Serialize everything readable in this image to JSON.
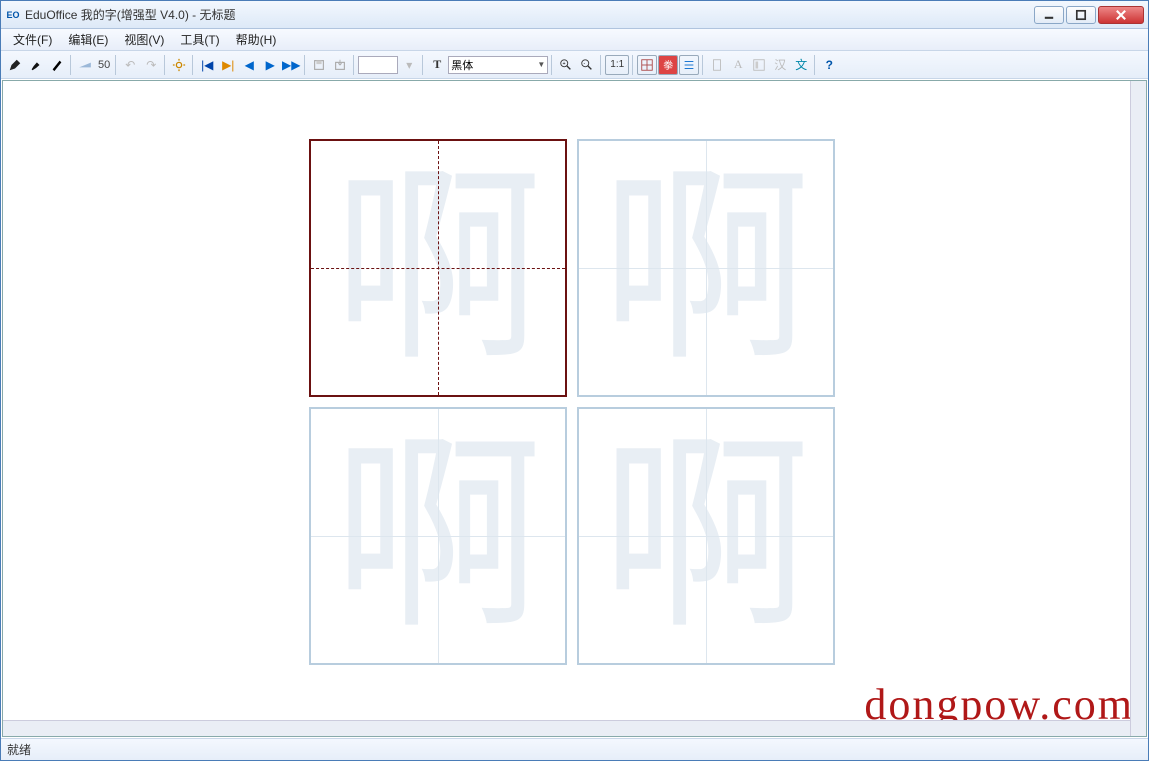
{
  "titlebar": {
    "app": "EduOffice 我的字(增强型 V4.0) - 无标题"
  },
  "menu": {
    "file": "文件(F)",
    "edit": "编辑(E)",
    "view": "视图(V)",
    "tools": "工具(T)",
    "help": "帮助(H)"
  },
  "toolbar": {
    "brush_num": "50",
    "text_input": "",
    "font_label": "黑体",
    "zoom_11": "1:1",
    "btn_A": "A",
    "btn_han": "汉",
    "btn_wen": "文",
    "btn_T": "T",
    "btn_help": "?"
  },
  "grid": {
    "ghost_char": "啊"
  },
  "status": {
    "ready": "就绪"
  },
  "watermark": "dongpow.com"
}
